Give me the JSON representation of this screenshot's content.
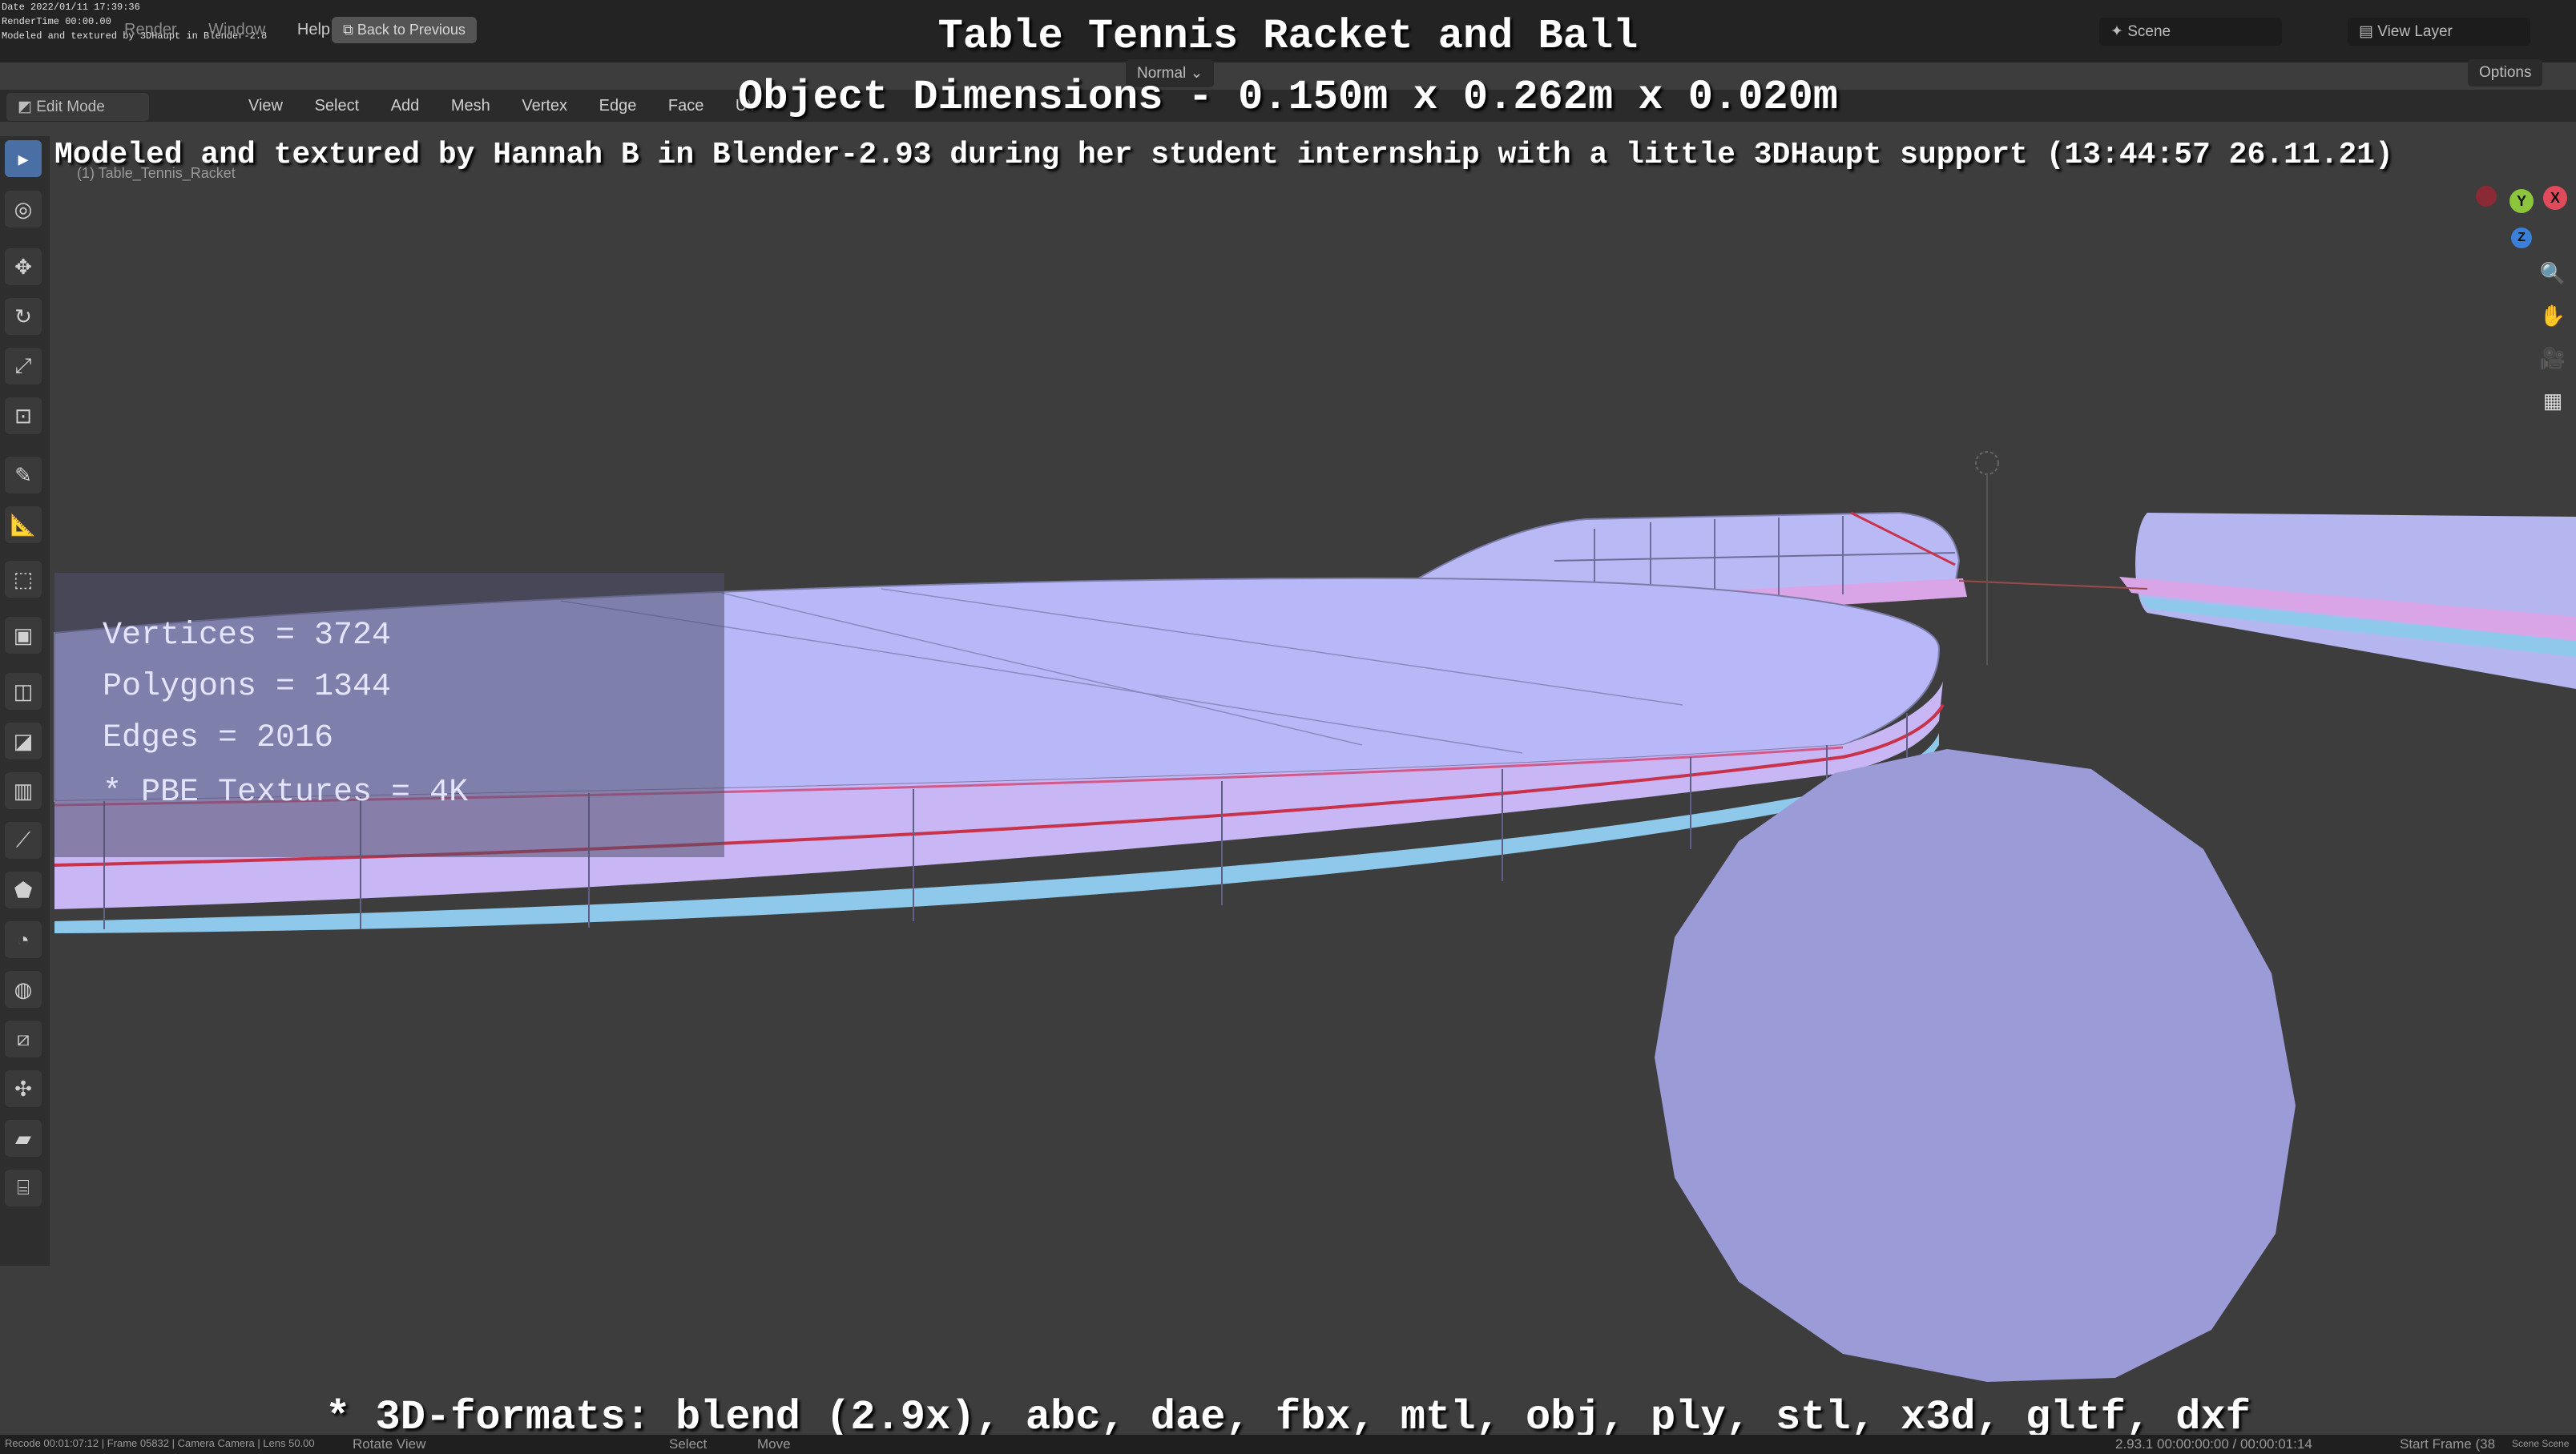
{
  "overlay": {
    "date": "Date 2022/01/11 17:39:36",
    "rendertime": "RenderTime 00:00.00",
    "modeled_small": "Modeled and textured by 3DHaupt in Blender-2.8"
  },
  "titles": {
    "title": "Table Tennis Racket and Ball",
    "dimensions": "Object Dimensions -  0.150m x 0.262m x 0.020m",
    "credit": "Modeled and textured by Hannah B in Blender-2.93 during her student internship with a little 3DHaupt support (13:44:57 26.11.21)",
    "formats": "* 3D-formats: blend (2.9x), abc, dae, fbx, mtl, obj, ply, stl, x3d, gltf, dxf"
  },
  "stats": {
    "vertices": "Vertices = 3724",
    "polygons": "Polygons = 1344",
    "edges": "Edges = 2016",
    "textures": "* PBE Textures = 4K"
  },
  "topbar": {
    "menus": [
      "Render",
      "Window",
      "Help"
    ],
    "back_button": "Back to Previous",
    "scene": "Scene",
    "view_layer": "View Layer"
  },
  "toolbar": {
    "orientation": "Normal",
    "options": "Options"
  },
  "modebar": {
    "mode": "Edit Mode",
    "menus": [
      "View",
      "Select",
      "Add",
      "Mesh",
      "Vertex",
      "Edge",
      "Face",
      "UV"
    ]
  },
  "viewport": {
    "object_label": "(1) Table_Tennis_Racket"
  },
  "gizmo": {
    "y": "Y",
    "x": "X",
    "z": "Z"
  },
  "statusbar": {
    "left": "Recode 00:01:07:12 | Frame 05832 | Camera Camera | Lens 50.00",
    "rotate": "Rotate View",
    "select": "Select",
    "move": "Move",
    "frames": "2.93.1  00:00:00:00 / 00:00:01:14",
    "start_frame": "Start Frame (38",
    "scene_right": "Scene Scene"
  },
  "colors": {
    "viewport_bg": "#3d3d3d",
    "mesh_face": "#b8b8f8",
    "mesh_edge_red": "#c8324a",
    "ball": "#9b9bd8",
    "gizmo_x": "#e04a5a",
    "gizmo_y": "#8cc43c",
    "gizmo_z": "#3a7fd8"
  },
  "icons": [
    "select-box-icon",
    "cursor-icon",
    "move-icon",
    "rotate-icon",
    "scale-icon",
    "transform-icon",
    "annotate-icon",
    "measure-icon",
    "add-cube-icon",
    "extrude-icon",
    "inset-icon",
    "bevel-icon",
    "loop-cut-icon",
    "knife-icon",
    "poly-build-icon",
    "spin-icon",
    "smooth-icon",
    "edge-slide-icon",
    "shrink-icon",
    "shear-icon",
    "rip-icon",
    "zoom-icon",
    "hand-icon",
    "camera-icon",
    "grid-icon"
  ]
}
